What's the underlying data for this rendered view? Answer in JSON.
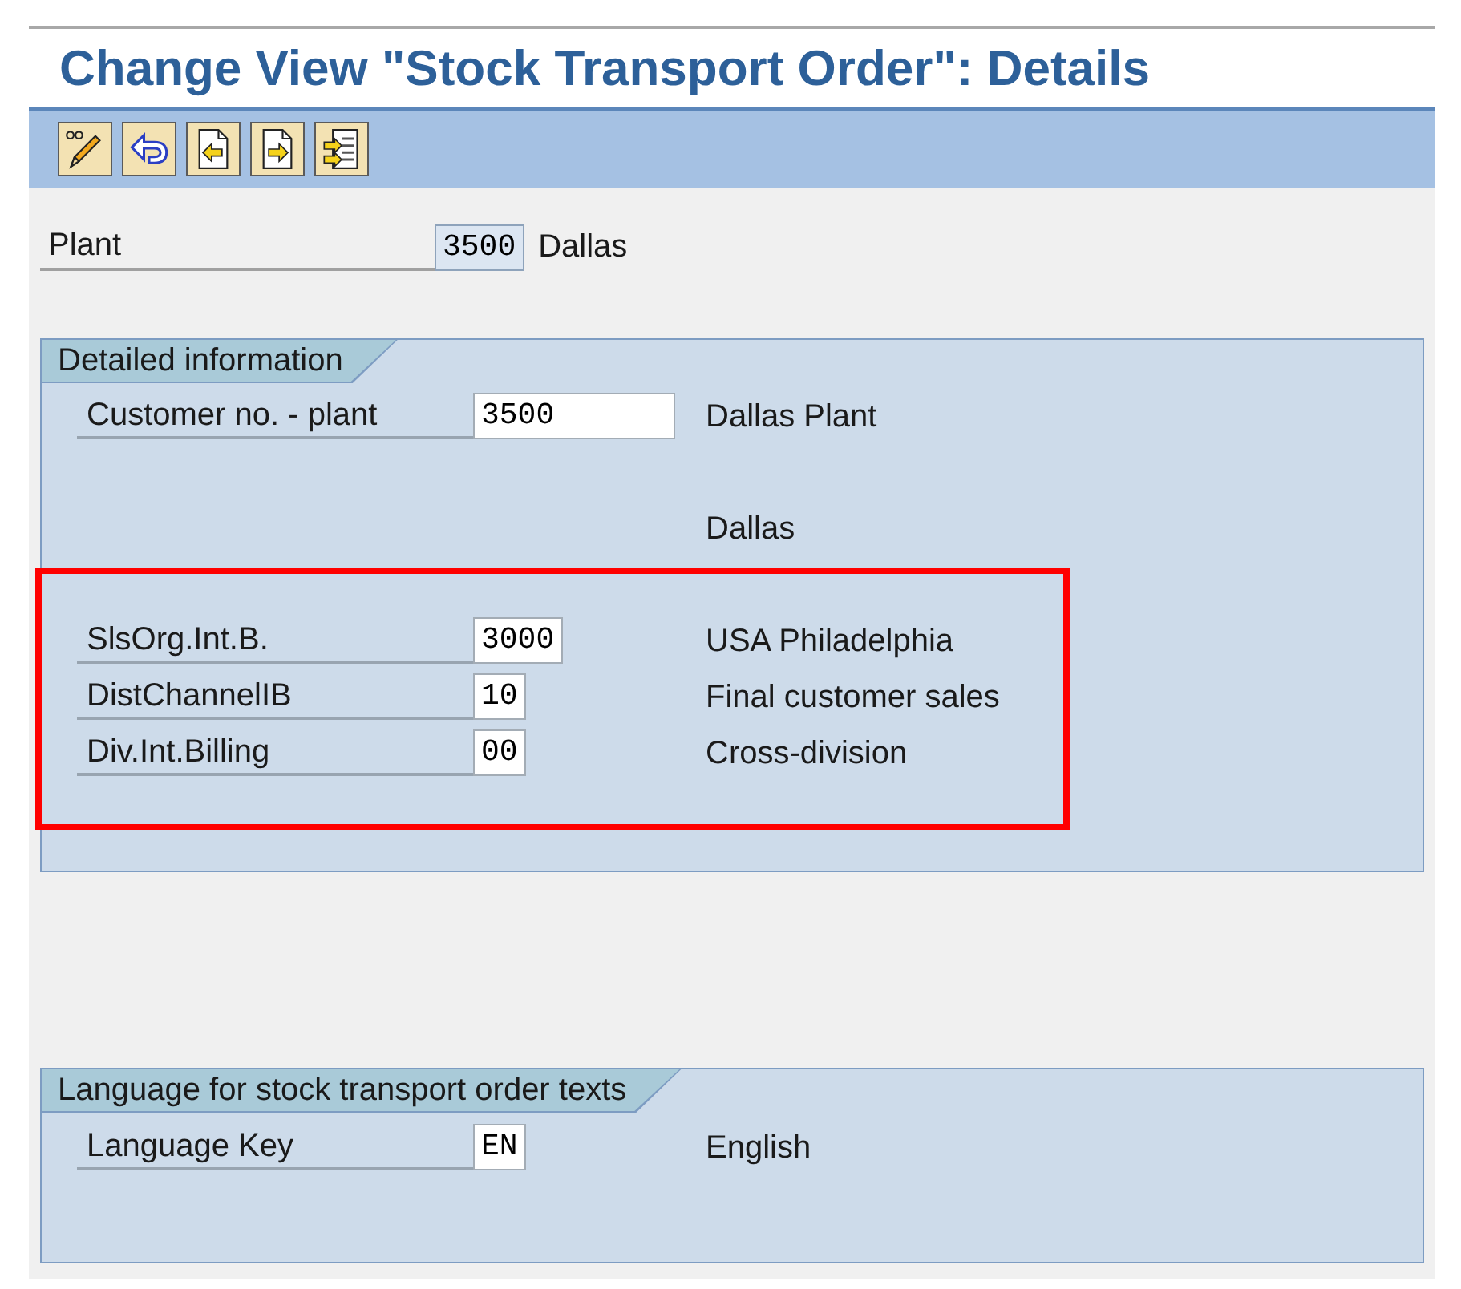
{
  "window": {
    "title": "Change View \"Stock Transport Order\": Details"
  },
  "toolbar": {
    "buttons": [
      {
        "kind": "display-change"
      },
      {
        "kind": "undo"
      },
      {
        "kind": "previous"
      },
      {
        "kind": "next"
      },
      {
        "kind": "other"
      }
    ]
  },
  "plant": {
    "label": "Plant",
    "value": "3500",
    "description": "Dallas",
    "editable": false
  },
  "detailed_information": {
    "title": "Detailed information",
    "rows": [
      {
        "kind": "long-field",
        "label": "Customer no. - plant",
        "value": "3500",
        "description": "Dallas Plant",
        "editable": true
      },
      {
        "kind": "text",
        "description": "Dallas"
      }
    ],
    "highlighted_rows": [
      {
        "kind": "field",
        "label": "SlsOrg.Int.B.",
        "value": "3000",
        "description": "USA Philadelphia",
        "editable": true
      },
      {
        "kind": "field",
        "label": "DistChannelIB",
        "value": "10",
        "description": "Final customer sales",
        "editable": true
      },
      {
        "kind": "field",
        "label": "Div.Int.Billing",
        "value": "00",
        "description": "Cross-division",
        "editable": true
      }
    ]
  },
  "language_texts": {
    "title": "Language for stock transport order texts",
    "rows": [
      {
        "kind": "field",
        "label": "Language Key",
        "value": "EN",
        "description": "English",
        "editable": true
      }
    ]
  }
}
